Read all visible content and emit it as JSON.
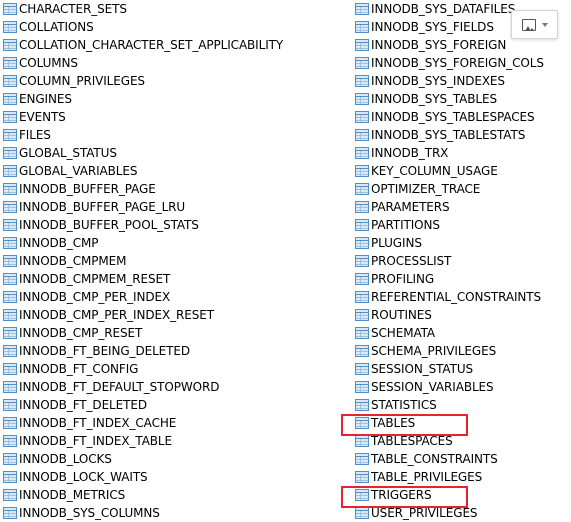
{
  "left_column": [
    "CHARACTER_SETS",
    "COLLATIONS",
    "COLLATION_CHARACTER_SET_APPLICABILITY",
    "COLUMNS",
    "COLUMN_PRIVILEGES",
    "ENGINES",
    "EVENTS",
    "FILES",
    "GLOBAL_STATUS",
    "GLOBAL_VARIABLES",
    "INNODB_BUFFER_PAGE",
    "INNODB_BUFFER_PAGE_LRU",
    "INNODB_BUFFER_POOL_STATS",
    "INNODB_CMP",
    "INNODB_CMPMEM",
    "INNODB_CMPMEM_RESET",
    "INNODB_CMP_PER_INDEX",
    "INNODB_CMP_PER_INDEX_RESET",
    "INNODB_CMP_RESET",
    "INNODB_FT_BEING_DELETED",
    "INNODB_FT_CONFIG",
    "INNODB_FT_DEFAULT_STOPWORD",
    "INNODB_FT_DELETED",
    "INNODB_FT_INDEX_CACHE",
    "INNODB_FT_INDEX_TABLE",
    "INNODB_LOCKS",
    "INNODB_LOCK_WAITS",
    "INNODB_METRICS",
    "INNODB_SYS_COLUMNS"
  ],
  "right_column": [
    "INNODB_SYS_DATAFILES",
    "INNODB_SYS_FIELDS",
    "INNODB_SYS_FOREIGN",
    "INNODB_SYS_FOREIGN_COLS",
    "INNODB_SYS_INDEXES",
    "INNODB_SYS_TABLES",
    "INNODB_SYS_TABLESPACES",
    "INNODB_SYS_TABLESTATS",
    "INNODB_TRX",
    "KEY_COLUMN_USAGE",
    "OPTIMIZER_TRACE",
    "PARAMETERS",
    "PARTITIONS",
    "PLUGINS",
    "PROCESSLIST",
    "PROFILING",
    "REFERENTIAL_CONSTRAINTS",
    "ROUTINES",
    "SCHEMATA",
    "SCHEMA_PRIVILEGES",
    "SESSION_STATUS",
    "SESSION_VARIABLES",
    "STATISTICS",
    "TABLES",
    "TABLESPACES",
    "TABLE_CONSTRAINTS",
    "TABLE_PRIVILEGES",
    "TRIGGERS",
    "USER_PRIVILEGES"
  ],
  "highlighted_items": [
    "TABLES",
    "TRIGGERS"
  ],
  "icons": {
    "table_item": "table-icon",
    "image_tool": "image-icon",
    "image_tool_dropdown": "chevron-down-icon"
  },
  "colors": {
    "highlight": "#e8232b",
    "table_icon": "#4f8fc7"
  }
}
